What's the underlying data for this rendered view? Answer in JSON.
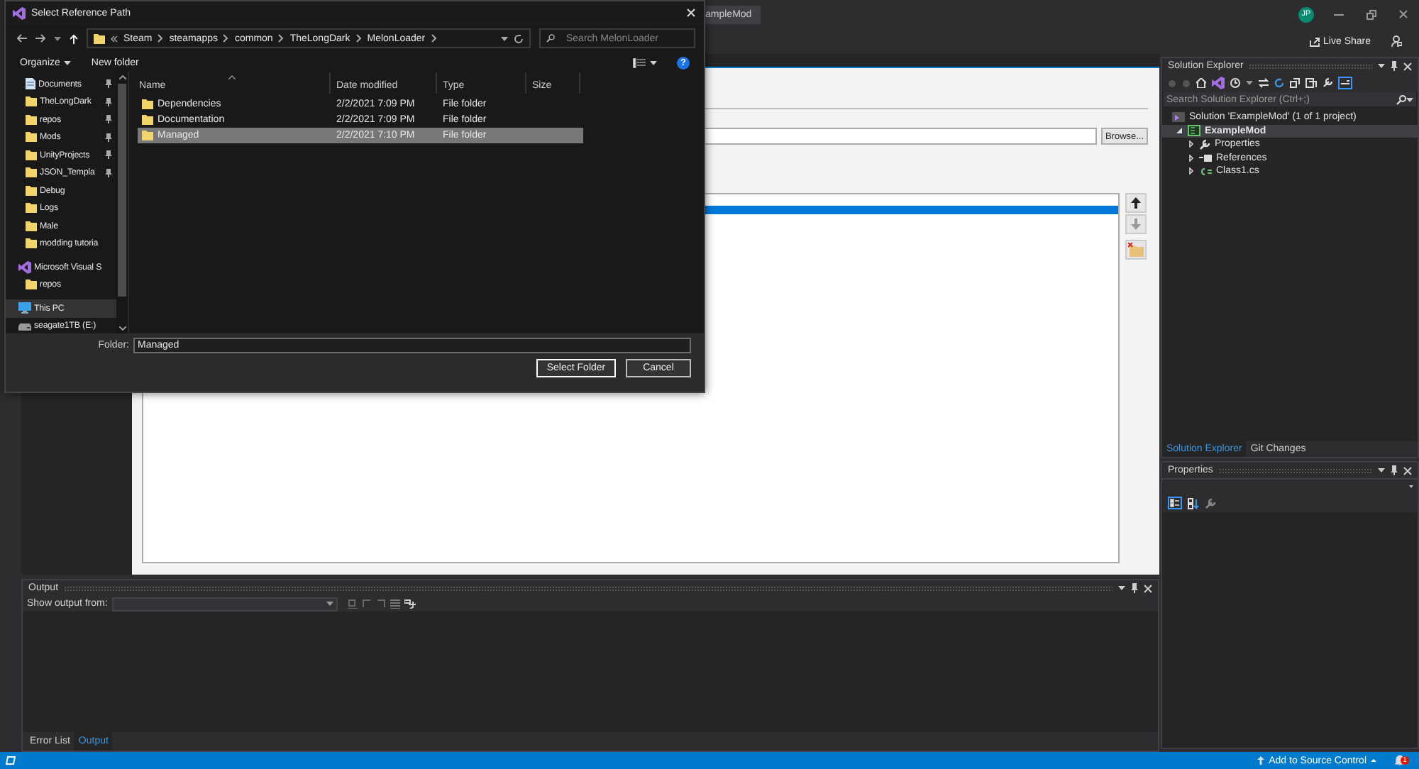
{
  "ide": {
    "document_tab": "ampleMod",
    "user_initials": "JP",
    "live_share": "Live Share"
  },
  "property_page": {
    "browse_button": "Browse...",
    "reference_paths": [
      {
        "selected": true
      }
    ]
  },
  "output": {
    "title": "Output",
    "show_output_from": "Show output from:",
    "tabs": [
      {
        "label": "Error List",
        "selected": false
      },
      {
        "label": "Output",
        "selected": true
      }
    ]
  },
  "solution_explorer": {
    "title": "Solution Explorer",
    "search_placeholder": "Search Solution Explorer (Ctrl+;)",
    "tree": [
      {
        "label": "Solution 'ExampleMod' (1 of 1 project)",
        "kind": "solution",
        "selected": false,
        "children": [
          {
            "label": "ExampleMod",
            "kind": "project",
            "selected": true,
            "expanded": true,
            "children": [
              {
                "label": "Properties",
                "kind": "properties",
                "selected": false,
                "expanded": false
              },
              {
                "label": "References",
                "kind": "references",
                "selected": false,
                "expanded": false
              },
              {
                "label": "Class1.cs",
                "kind": "file",
                "selected": false,
                "expanded": false
              }
            ]
          }
        ]
      }
    ],
    "tabs": [
      {
        "label": "Solution Explorer",
        "selected": true
      },
      {
        "label": "Git Changes",
        "selected": false
      }
    ]
  },
  "properties": {
    "title": "Properties"
  },
  "status_bar": {
    "source_control": "Add to Source Control",
    "notification_badge": "1"
  },
  "dialog": {
    "title": "Select Reference Path",
    "breadcrumb": [
      "Steam",
      "steamapps",
      "common",
      "TheLongDark",
      "MelonLoader"
    ],
    "search_placeholder": "Search MelonLoader",
    "organize": "Organize",
    "new_folder": "New folder",
    "help": "?",
    "quick_access": [
      {
        "label": "Documents",
        "kind": "document",
        "pinned": true,
        "selected": false
      },
      {
        "label": "TheLongDark",
        "kind": "folder",
        "pinned": true,
        "selected": false
      },
      {
        "label": "repos",
        "kind": "folder",
        "pinned": true,
        "selected": false
      },
      {
        "label": "Mods",
        "kind": "folder",
        "pinned": true,
        "selected": false
      },
      {
        "label": "UnityProjects",
        "kind": "folder",
        "pinned": true,
        "selected": false
      },
      {
        "label": "JSON_Templa",
        "kind": "folder",
        "pinned": true,
        "selected": false
      },
      {
        "label": "Debug",
        "kind": "folder",
        "pinned": false,
        "selected": false
      },
      {
        "label": "Logs",
        "kind": "folder",
        "pinned": false,
        "selected": false
      },
      {
        "label": "Male",
        "kind": "folder",
        "pinned": false,
        "selected": false
      },
      {
        "label": "modding tutoria",
        "kind": "folder",
        "pinned": false,
        "selected": false
      }
    ],
    "roots": [
      {
        "label": "Microsoft Visual S",
        "kind": "vs",
        "selected": false,
        "children": [
          {
            "label": "repos",
            "kind": "folder",
            "selected": false
          }
        ]
      },
      {
        "label": "This PC",
        "kind": "pc",
        "selected": true
      },
      {
        "label": "seagate1TB (E:)",
        "kind": "drive",
        "selected": false
      }
    ],
    "columns": [
      "Name",
      "Date modified",
      "Type",
      "Size"
    ],
    "files": [
      {
        "name": "Dependencies",
        "date": "2/2/2021 7:09 PM",
        "type": "File folder",
        "selected": false
      },
      {
        "name": "Documentation",
        "date": "2/2/2021 7:09 PM",
        "type": "File folder",
        "selected": false
      },
      {
        "name": "Managed",
        "date": "2/2/2021 7:10 PM",
        "type": "File folder",
        "selected": true
      }
    ],
    "folder_label": "Folder:",
    "folder_value": "Managed",
    "buttons": [
      "Select Folder",
      "Cancel"
    ]
  }
}
